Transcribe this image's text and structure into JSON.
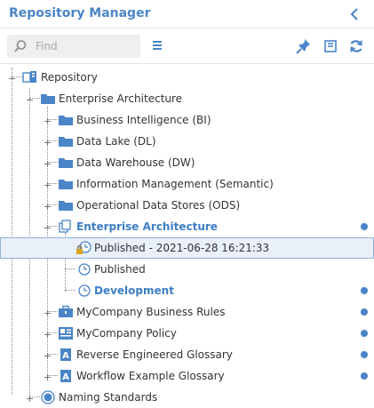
{
  "header": {
    "title": "Repository Manager"
  },
  "toolbar": {
    "search_placeholder": "Find"
  },
  "tree": {
    "root": "Repository",
    "enterprise_architecture": "Enterprise Architecture",
    "items": [
      "Business Intelligence (BI)",
      "Data Lake (DL)",
      "Data Warehouse (DW)",
      "Information Management (Semantic)",
      "Operational Data Stores (ODS)"
    ],
    "ea_model": "Enterprise Architecture",
    "versions": {
      "published_dated": "Published - 2021-06-28 16:21:33",
      "published": "Published",
      "development": "Development"
    },
    "business_rules": "MyCompany Business Rules",
    "policy": "MyCompany Policy",
    "glossary_reverse": "Reverse Engineered Glossary",
    "glossary_workflow": "Workflow Example Glossary",
    "naming_standards": "Naming Standards"
  },
  "colors": {
    "accent": "#4a85c7",
    "selected_bg": "#e9f0f8",
    "selected_border": "#8eb3da"
  },
  "icons": [
    "chevron-left-icon",
    "search-icon",
    "menu-icon",
    "pin-icon",
    "collapse-all-icon",
    "refresh-icon",
    "folder-icon",
    "clock-icon",
    "glossary-icon",
    "briefcase-icon",
    "policy-icon",
    "naming-standards-icon",
    "repository-icon",
    "model-icon",
    "lock-icon"
  ]
}
